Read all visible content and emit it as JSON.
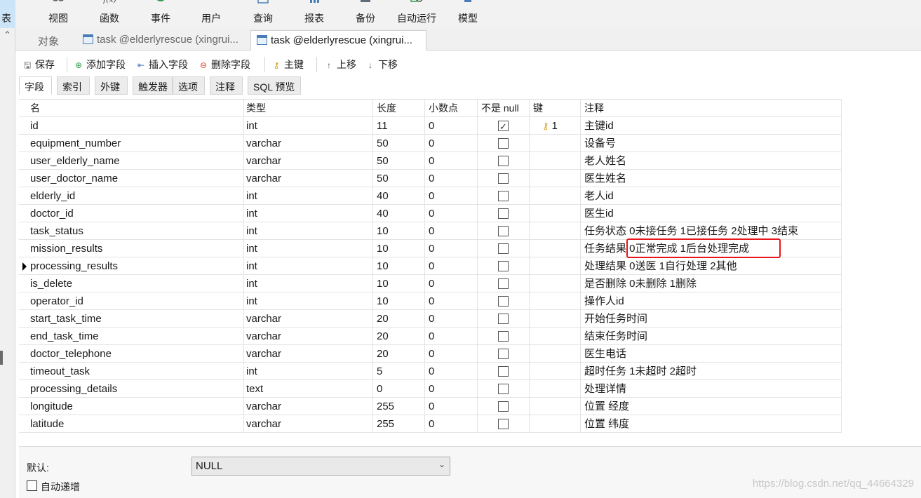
{
  "ribbon": {
    "items": [
      {
        "label": "表",
        "icon": "table-icon",
        "active": true
      },
      {
        "label": "视图",
        "icon": "view-icon"
      },
      {
        "label": "函数",
        "icon": "function-icon"
      },
      {
        "label": "事件",
        "icon": "event-icon"
      },
      {
        "label": "用户",
        "icon": "user-icon"
      },
      {
        "label": "查询",
        "icon": "query-icon"
      },
      {
        "label": "报表",
        "icon": "report-icon"
      },
      {
        "label": "备份",
        "icon": "backup-icon"
      },
      {
        "label": "自动运行",
        "icon": "autorun-icon"
      },
      {
        "label": "模型",
        "icon": "model-icon"
      }
    ]
  },
  "tabs": [
    {
      "label": "对象"
    },
    {
      "label": "task @elderlyrescue (xingrui..."
    },
    {
      "label": "task @elderlyrescue (xingrui..."
    }
  ],
  "toolbar": {
    "save": "保存",
    "add_field": "添加字段",
    "insert_field": "插入字段",
    "delete_field": "删除字段",
    "primary_key": "主键",
    "move_up": "上移",
    "move_down": "下移"
  },
  "subtabs": [
    "字段",
    "索引",
    "外键",
    "触发器",
    "选项",
    "注释",
    "SQL 预览"
  ],
  "grid": {
    "headers": {
      "name": "名",
      "type": "类型",
      "length": "长度",
      "decimals": "小数点",
      "not_null": "不是 null",
      "key": "键",
      "comment": "注释"
    },
    "rows": [
      {
        "name": "id",
        "type": "int",
        "length": "11",
        "decimals": "0",
        "not_null": true,
        "key": "1",
        "comment": "主键id"
      },
      {
        "name": "equipment_number",
        "type": "varchar",
        "length": "50",
        "decimals": "0",
        "not_null": false,
        "key": "",
        "comment": "设备号"
      },
      {
        "name": "user_elderly_name",
        "type": "varchar",
        "length": "50",
        "decimals": "0",
        "not_null": false,
        "key": "",
        "comment": "老人姓名"
      },
      {
        "name": "user_doctor_name",
        "type": "varchar",
        "length": "50",
        "decimals": "0",
        "not_null": false,
        "key": "",
        "comment": "医生姓名"
      },
      {
        "name": "elderly_id",
        "type": "int",
        "length": "40",
        "decimals": "0",
        "not_null": false,
        "key": "",
        "comment": "老人id"
      },
      {
        "name": "doctor_id",
        "type": "int",
        "length": "40",
        "decimals": "0",
        "not_null": false,
        "key": "",
        "comment": "医生id"
      },
      {
        "name": "task_status",
        "type": "int",
        "length": "10",
        "decimals": "0",
        "not_null": false,
        "key": "",
        "comment": "任务状态 0未接任务  1已接任务  2处理中  3结束"
      },
      {
        "name": "mission_results",
        "type": "int",
        "length": "10",
        "decimals": "0",
        "not_null": false,
        "key": "",
        "comment": "任务结果  0正常完成    1后台处理完成"
      },
      {
        "name": "processing_results",
        "type": "int",
        "length": "10",
        "decimals": "0",
        "not_null": false,
        "key": "",
        "comment": "处理结果  0送医   1自行处理 2其他",
        "current": true
      },
      {
        "name": "is_delete",
        "type": "int",
        "length": "10",
        "decimals": "0",
        "not_null": false,
        "key": "",
        "comment": "是否删除  0未删除   1删除"
      },
      {
        "name": "operator_id",
        "type": "int",
        "length": "10",
        "decimals": "0",
        "not_null": false,
        "key": "",
        "comment": "操作人id"
      },
      {
        "name": "start_task_time",
        "type": "varchar",
        "length": "20",
        "decimals": "0",
        "not_null": false,
        "key": "",
        "comment": "开始任务时间"
      },
      {
        "name": "end_task_time",
        "type": "varchar",
        "length": "20",
        "decimals": "0",
        "not_null": false,
        "key": "",
        "comment": "结束任务时间"
      },
      {
        "name": "doctor_telephone",
        "type": "varchar",
        "length": "20",
        "decimals": "0",
        "not_null": false,
        "key": "",
        "comment": "医生电话"
      },
      {
        "name": "timeout_task",
        "type": "int",
        "length": "5",
        "decimals": "0",
        "not_null": false,
        "key": "",
        "comment": "超时任务   1未超时  2超时"
      },
      {
        "name": "processing_details",
        "type": "text",
        "length": "0",
        "decimals": "0",
        "not_null": false,
        "key": "",
        "comment": "处理详情"
      },
      {
        "name": "longitude",
        "type": "varchar",
        "length": "255",
        "decimals": "0",
        "not_null": false,
        "key": "",
        "comment": "位置  经度"
      },
      {
        "name": "latitude",
        "type": "varchar",
        "length": "255",
        "decimals": "0",
        "not_null": false,
        "key": "",
        "comment": "位置  纬度"
      }
    ]
  },
  "bottom": {
    "default_label": "默认:",
    "default_value": "NULL",
    "auto_increment_label": "自动递增"
  },
  "watermark": "https://blog.csdn.net/qq_44664329",
  "colors": {
    "highlight_border": "#e8161b",
    "active_ribbon": "#cce4f7",
    "key_icon": "#d89b1a"
  }
}
